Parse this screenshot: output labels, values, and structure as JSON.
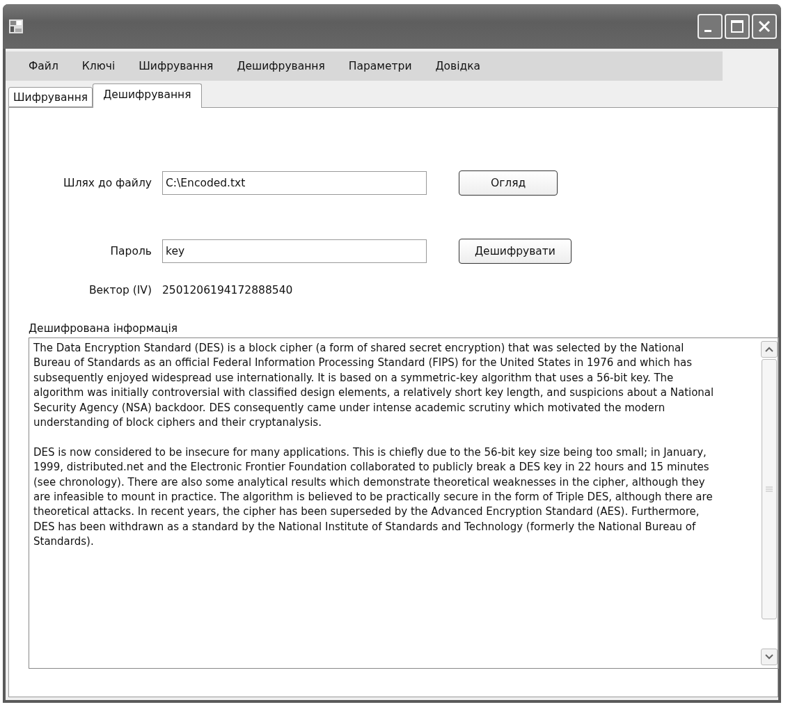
{
  "menu": [
    "Файл",
    "Ключі",
    "Шифрування",
    "Дешифрування",
    "Параметри",
    "Довідка"
  ],
  "tabs": [
    {
      "label": "Шифрування",
      "selected": false
    },
    {
      "label": "Дешифрування",
      "selected": true
    }
  ],
  "form": {
    "path_label": "Шлях до файлу",
    "path_value": "C:\\Encoded.txt",
    "browse_button": "Огляд",
    "password_label": "Пароль",
    "password_value": "key",
    "decrypt_button": "Дешифрувати",
    "iv_label": "Вектор (IV)",
    "iv_value": "2501206194172888540"
  },
  "output": {
    "label": "Дешифрована інформація",
    "paragraphs": [
      "The Data Encryption Standard (DES) is a block cipher (a form of shared secret encryption) that was selected by the National Bureau of Standards as an official Federal Information Processing Standard (FIPS) for the United States in 1976 and which has subsequently enjoyed widespread use internationally. It is based on a symmetric-key algorithm that uses a 56-bit key. The algorithm was initially controversial with classified design elements, a relatively short key length, and suspicions about a National Security Agency (NSA) backdoor. DES consequently came under intense academic scrutiny which motivated the modern understanding of block ciphers and their cryptanalysis.",
      "DES is now considered to be insecure for many applications. This is chiefly due to the 56-bit key size being too small; in January, 1999, distributed.net and the Electronic Frontier Foundation collaborated to publicly break a DES key in 22 hours and 15 minutes (see chronology). There are also some analytical results which demonstrate theoretical weaknesses in the cipher, although they are infeasible to mount in practice. The algorithm is believed to be practically secure in the form of Triple DES, although there are theoretical attacks. In recent years, the cipher has been superseded by the Advanced Encryption Standard (AES). Furthermore, DES has been withdrawn as a standard by the National Institute of Standards and Technology (formerly the National Bureau of Standards)."
    ]
  }
}
